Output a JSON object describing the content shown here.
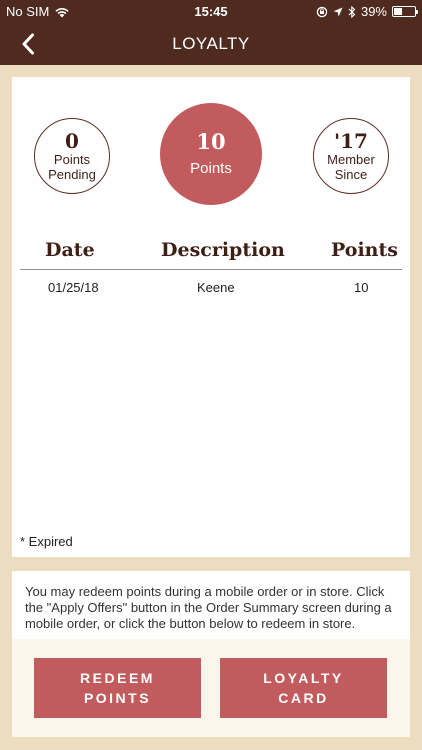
{
  "status_bar": {
    "carrier": "No SIM",
    "time": "15:45",
    "battery_percent": "39%",
    "battery_level": 0.39
  },
  "nav": {
    "title": "LOYALTY",
    "back_icon": "chevron-left-icon"
  },
  "summary": {
    "pending": {
      "value": "0",
      "label_line1": "Points",
      "label_line2": "Pending"
    },
    "points": {
      "value": "10",
      "label": "Points"
    },
    "member": {
      "value": "'17",
      "label_line1": "Member",
      "label_line2": "Since"
    }
  },
  "table": {
    "headers": [
      "Date",
      "Description",
      "Points"
    ],
    "rows": [
      {
        "date": "01/25/18",
        "description": "Keene",
        "points": "10"
      }
    ]
  },
  "expired_note": "* Expired",
  "info_text": "You may redeem points during a mobile order or in store. Click the \"Apply Offers\" button in the Order Summary screen during a mobile order, or click the button below to redeem in store.",
  "buttons": {
    "redeem": {
      "line1": "REDEEM",
      "line2": "POINTS"
    },
    "card": {
      "line1": "LOYALTY",
      "line2": "CARD"
    }
  },
  "colors": {
    "header_bg": "#4e2a1f",
    "page_bg": "#ecdcc0",
    "accent": "#c25b5d"
  }
}
